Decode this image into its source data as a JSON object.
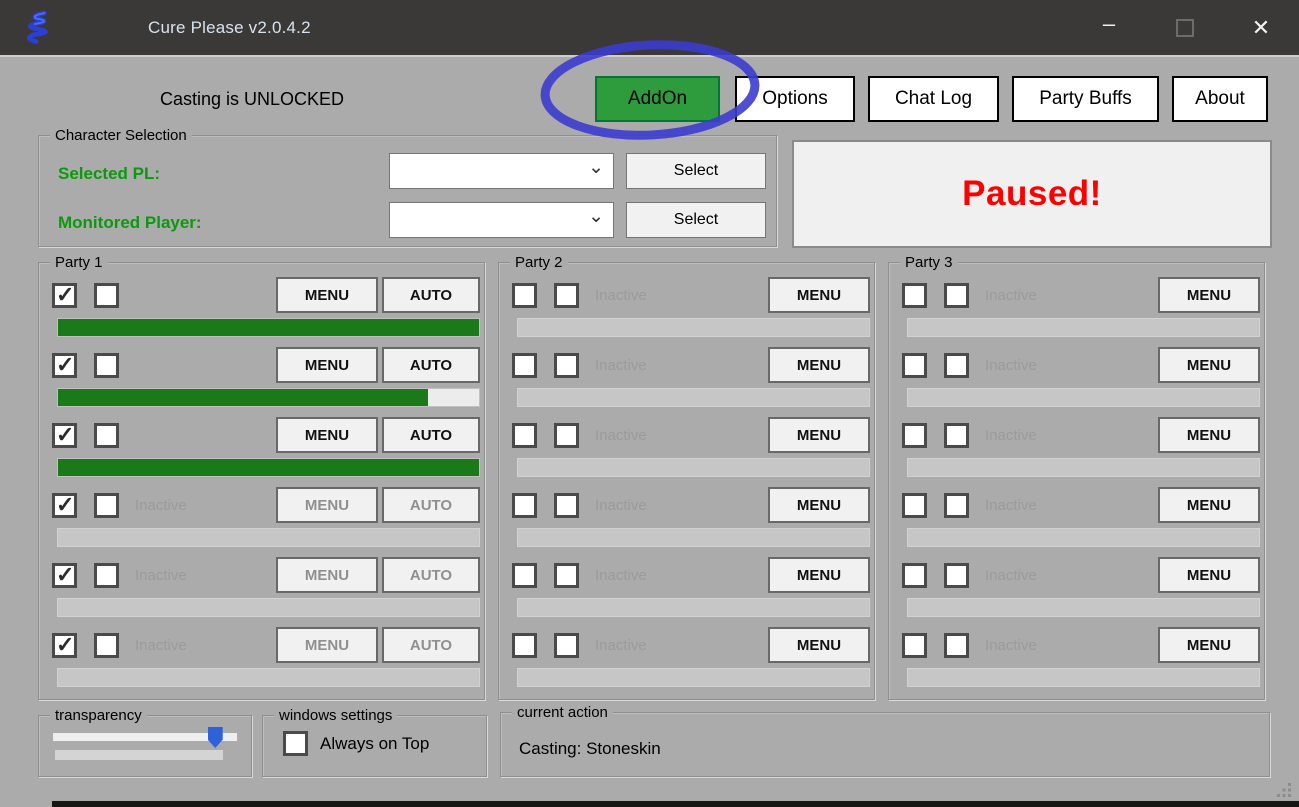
{
  "window": {
    "title": "Cure Please v2.0.4.2"
  },
  "icons": {
    "minimize": "–",
    "close": "✕",
    "chevron_down": "⌄"
  },
  "colors": {
    "titlebar": "#3b3938",
    "body_bg": "#ababab",
    "addon_green": "#2e9b3d",
    "label_green": "#0c9a0c",
    "progress_green": "#1a7a1a",
    "paused_red": "#ff0000",
    "annotation_blue": "#3c3ccf",
    "slider_blue": "#2f62d8"
  },
  "header": {
    "casting_status": "Casting is UNLOCKED",
    "addon_button": "AddOn",
    "options_button": "Options",
    "chatlog_button": "Chat Log",
    "partybuffs_button": "Party Buffs",
    "about_button": "About"
  },
  "character_selection": {
    "group_label": "Character Selection",
    "selected_pl_label": "Selected PL:",
    "monitored_player_label": "Monitored Player:",
    "selected_pl_value": "",
    "monitored_player_value": "",
    "select_button_1": "Select",
    "select_button_2": "Select"
  },
  "status_panel": {
    "text": "Paused!"
  },
  "parties": [
    {
      "label": "Party 1",
      "rows": [
        {
          "checked1": true,
          "checked2": false,
          "status": "",
          "menu_label": "MENU",
          "auto_label": "AUTO",
          "buttons_disabled": false,
          "progress": 100
        },
        {
          "checked1": true,
          "checked2": false,
          "status": "",
          "menu_label": "MENU",
          "auto_label": "AUTO",
          "buttons_disabled": false,
          "progress": 88
        },
        {
          "checked1": true,
          "checked2": false,
          "status": "",
          "menu_label": "MENU",
          "auto_label": "AUTO",
          "buttons_disabled": false,
          "progress": 100
        },
        {
          "checked1": true,
          "checked2": false,
          "status": "Inactive",
          "menu_label": "MENU",
          "auto_label": "AUTO",
          "buttons_disabled": true,
          "progress": 0
        },
        {
          "checked1": true,
          "checked2": false,
          "status": "Inactive",
          "menu_label": "MENU",
          "auto_label": "AUTO",
          "buttons_disabled": true,
          "progress": 0
        },
        {
          "checked1": true,
          "checked2": false,
          "status": "Inactive",
          "menu_label": "MENU",
          "auto_label": "AUTO",
          "buttons_disabled": true,
          "progress": 0
        }
      ]
    },
    {
      "label": "Party 2",
      "rows": [
        {
          "checked1": false,
          "checked2": false,
          "status": "Inactive",
          "menu_label": "MENU",
          "buttons_disabled": false,
          "progress": 0
        },
        {
          "checked1": false,
          "checked2": false,
          "status": "Inactive",
          "menu_label": "MENU",
          "buttons_disabled": false,
          "progress": 0
        },
        {
          "checked1": false,
          "checked2": false,
          "status": "Inactive",
          "menu_label": "MENU",
          "buttons_disabled": false,
          "progress": 0
        },
        {
          "checked1": false,
          "checked2": false,
          "status": "Inactive",
          "menu_label": "MENU",
          "buttons_disabled": false,
          "progress": 0
        },
        {
          "checked1": false,
          "checked2": false,
          "status": "Inactive",
          "menu_label": "MENU",
          "buttons_disabled": false,
          "progress": 0
        },
        {
          "checked1": false,
          "checked2": false,
          "status": "Inactive",
          "menu_label": "MENU",
          "buttons_disabled": false,
          "progress": 0
        }
      ]
    },
    {
      "label": "Party 3",
      "rows": [
        {
          "checked1": false,
          "checked2": false,
          "status": "Inactive",
          "menu_label": "MENU",
          "buttons_disabled": false,
          "progress": 0
        },
        {
          "checked1": false,
          "checked2": false,
          "status": "Inactive",
          "menu_label": "MENU",
          "buttons_disabled": false,
          "progress": 0
        },
        {
          "checked1": false,
          "checked2": false,
          "status": "Inactive",
          "menu_label": "MENU",
          "buttons_disabled": false,
          "progress": 0
        },
        {
          "checked1": false,
          "checked2": false,
          "status": "Inactive",
          "menu_label": "MENU",
          "buttons_disabled": false,
          "progress": 0
        },
        {
          "checked1": false,
          "checked2": false,
          "status": "Inactive",
          "menu_label": "MENU",
          "buttons_disabled": false,
          "progress": 0
        },
        {
          "checked1": false,
          "checked2": false,
          "status": "Inactive",
          "menu_label": "MENU",
          "buttons_disabled": false,
          "progress": 0
        }
      ]
    }
  ],
  "footer": {
    "transparency_label": "transparency",
    "transparency_value": 92,
    "windows_settings_label": "windows settings",
    "always_on_top_label": "Always on Top",
    "always_on_top_checked": false,
    "current_action_label": "current action",
    "current_action_text": "Casting: Stoneskin"
  }
}
